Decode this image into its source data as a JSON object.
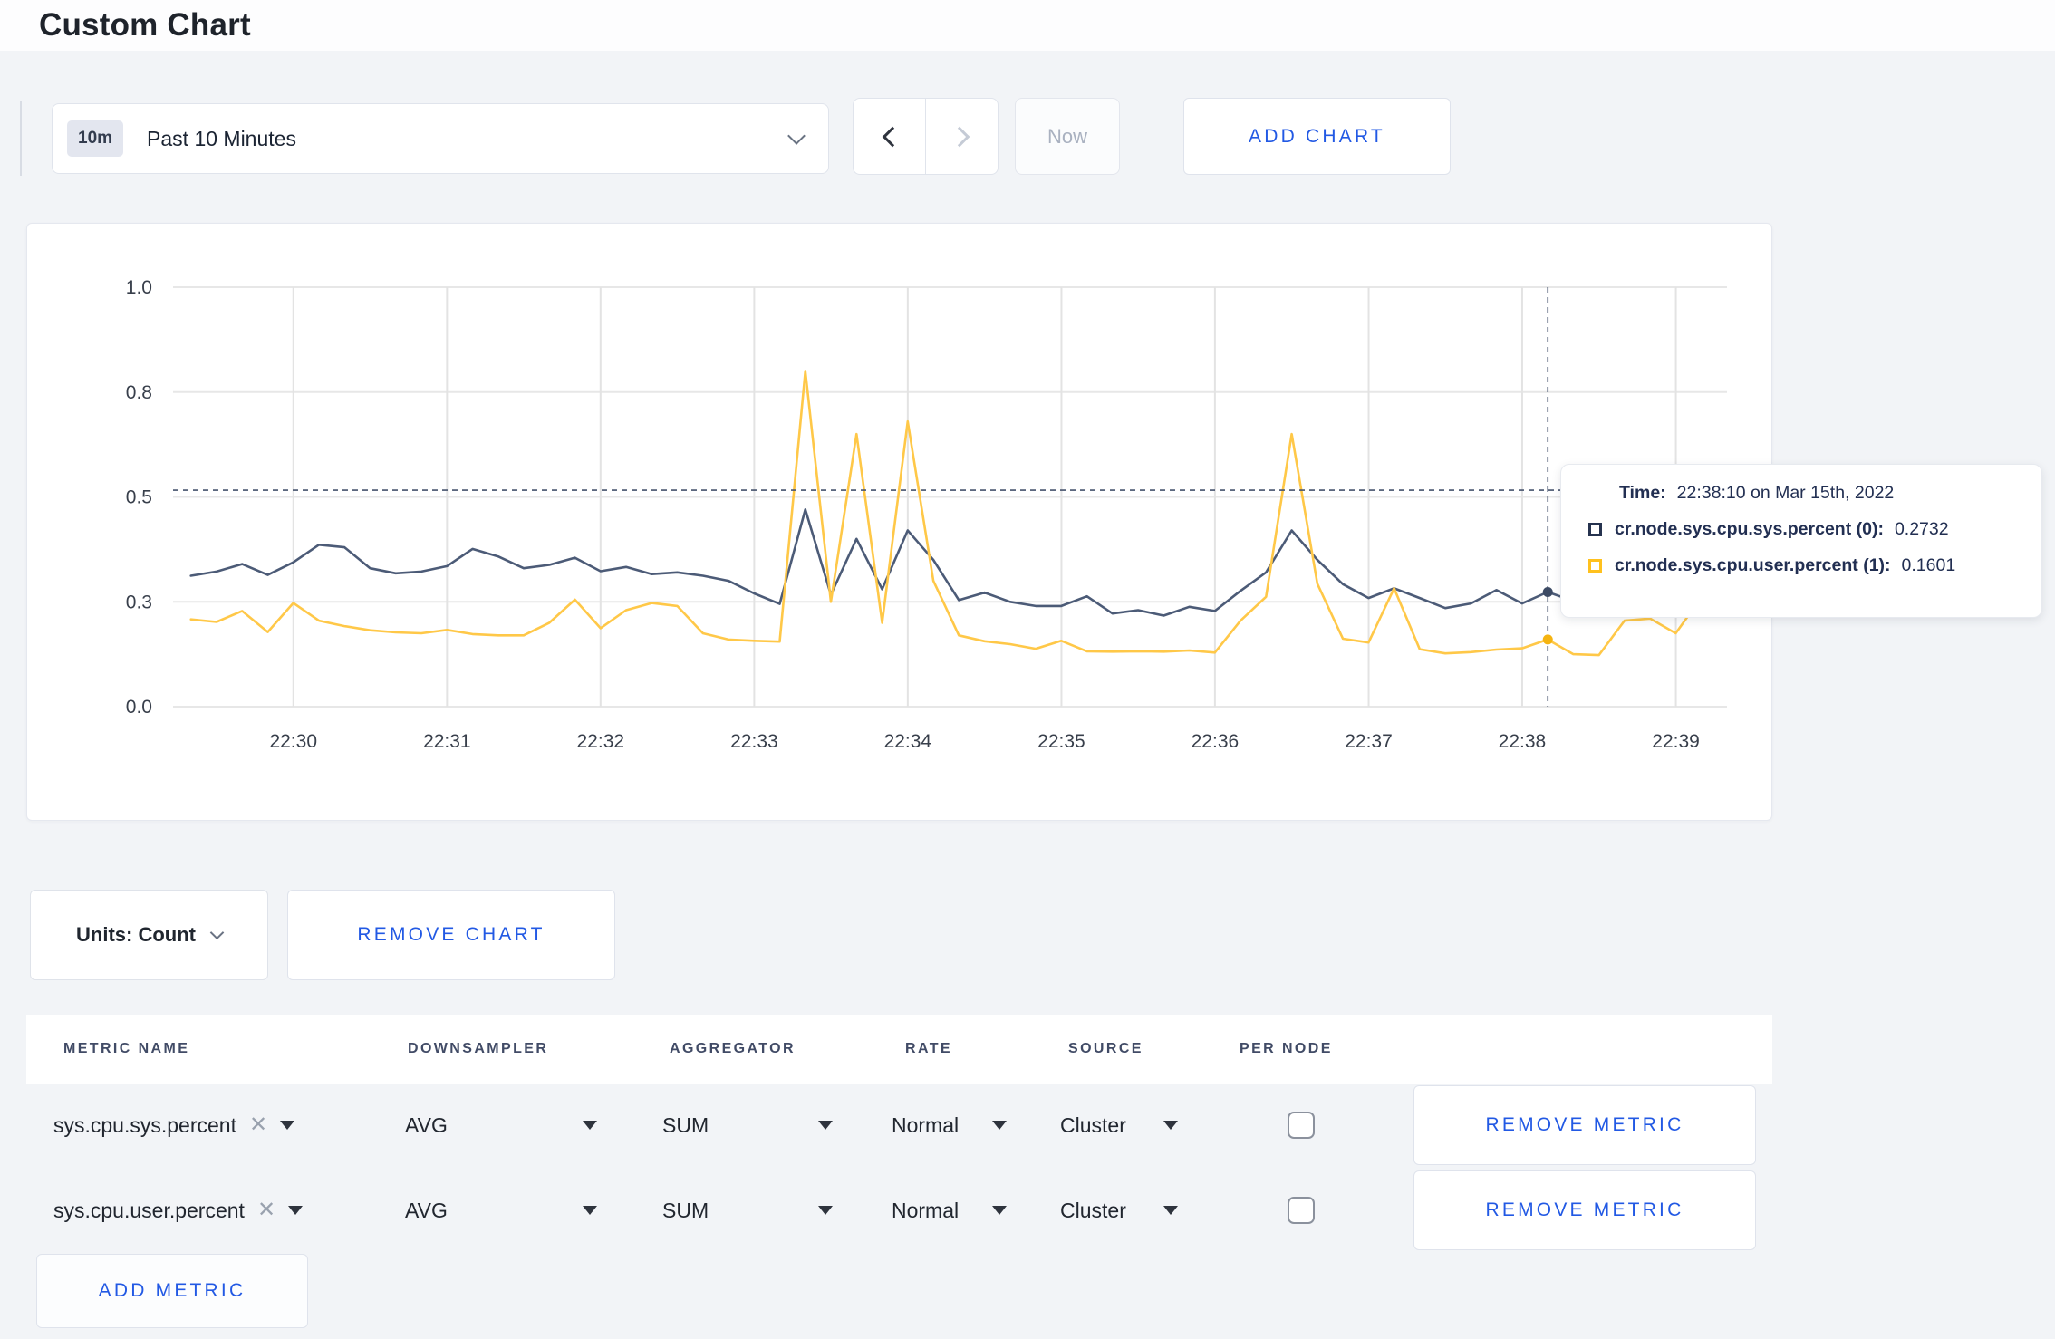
{
  "page_title": "Custom Chart",
  "toolbar": {
    "time_badge": "10m",
    "time_label": "Past 10 Minutes",
    "now_label": "Now",
    "add_chart_label": "ADD CHART"
  },
  "chart_controls": {
    "units_label": "Units: Count",
    "remove_chart_label": "REMOVE CHART",
    "add_metric_label": "ADD METRIC"
  },
  "tooltip": {
    "time_label": "Time:",
    "time_value": "22:38:10 on Mar 15th, 2022",
    "rows": [
      {
        "label": "cr.node.sys.cpu.sys.percent (0):",
        "value": "0.2732",
        "swatch_color": "#26334f"
      },
      {
        "label": "cr.node.sys.cpu.user.percent (1):",
        "value": "0.1601",
        "swatch_color": "#ffc11e"
      }
    ]
  },
  "metrics_table": {
    "headers": [
      "METRIC NAME",
      "DOWNSAMPLER",
      "AGGREGATOR",
      "RATE",
      "SOURCE",
      "PER NODE"
    ],
    "remove_metric_label": "REMOVE METRIC",
    "rows": [
      {
        "name": "sys.cpu.sys.percent",
        "downsampler": "AVG",
        "aggregator": "SUM",
        "rate": "Normal",
        "source": "Cluster",
        "per_node_checked": false
      },
      {
        "name": "sys.cpu.user.percent",
        "downsampler": "AVG",
        "aggregator": "SUM",
        "rate": "Normal",
        "source": "Cluster",
        "per_node_checked": false
      }
    ]
  },
  "colors": {
    "accent_blue": "#2259e4",
    "page_background": "#f2f4f7",
    "series_sys": "#4c5b77",
    "series_user": "#ffc848",
    "crosshair": "#46536d"
  },
  "chart_data": {
    "type": "line",
    "title": "",
    "xlabel": "",
    "ylabel": "",
    "ylim": [
      0,
      1
    ],
    "grid": true,
    "legend_position": "tooltip",
    "x_ticks": [
      {
        "label": "22:30",
        "frac": 0.0774
      },
      {
        "label": "22:31",
        "frac": 0.1763
      },
      {
        "label": "22:32",
        "frac": 0.2751
      },
      {
        "label": "22:33",
        "frac": 0.374
      },
      {
        "label": "22:34",
        "frac": 0.4728
      },
      {
        "label": "22:35",
        "frac": 0.5717
      },
      {
        "label": "22:36",
        "frac": 0.6705
      },
      {
        "label": "22:37",
        "frac": 0.7694
      },
      {
        "label": "22:38",
        "frac": 0.8682
      },
      {
        "label": "22:39",
        "frac": 0.9671
      }
    ],
    "y_ticks": [
      {
        "label": "0.0",
        "value": 0
      },
      {
        "label": "0.3",
        "value": 0.25
      },
      {
        "label": "0.5",
        "value": 0.5
      },
      {
        "label": "0.8",
        "value": 0.75
      },
      {
        "label": "1.0",
        "value": 1
      }
    ],
    "sample_interval_s": 10,
    "x_window": "22:29:20 - 22:39:20",
    "data_start_frac": 0.0115,
    "sample_step_frac": 0.016474,
    "series": [
      {
        "name": "cr.node.sys.cpu.sys.percent",
        "color": "#4c5b77",
        "dot_color": "#3c4a64",
        "values": [
          0.312,
          0.322,
          0.34,
          0.314,
          0.344,
          0.386,
          0.38,
          0.33,
          0.318,
          0.322,
          0.335,
          0.376,
          0.358,
          0.33,
          0.338,
          0.355,
          0.323,
          0.333,
          0.316,
          0.32,
          0.312,
          0.3,
          0.27,
          0.245,
          0.47,
          0.267,
          0.4,
          0.28,
          0.42,
          0.35,
          0.254,
          0.272,
          0.25,
          0.24,
          0.24,
          0.263,
          0.222,
          0.23,
          0.217,
          0.238,
          0.228,
          0.276,
          0.32,
          0.42,
          0.35,
          0.292,
          0.259,
          0.282,
          0.259,
          0.235,
          0.246,
          0.278,
          0.246,
          0.2732,
          0.252,
          0.262,
          0.285,
          0.27,
          0.284,
          0.262,
          0.29
        ]
      },
      {
        "name": "cr.node.sys.cpu.user.percent",
        "color": "#ffc848",
        "dot_color": "#f5b411",
        "values": [
          0.208,
          0.202,
          0.228,
          0.178,
          0.247,
          0.205,
          0.192,
          0.182,
          0.177,
          0.175,
          0.183,
          0.173,
          0.17,
          0.17,
          0.2,
          0.255,
          0.187,
          0.23,
          0.247,
          0.24,
          0.175,
          0.16,
          0.157,
          0.155,
          0.8,
          0.25,
          0.65,
          0.2,
          0.68,
          0.3,
          0.17,
          0.156,
          0.149,
          0.138,
          0.157,
          0.132,
          0.131,
          0.132,
          0.131,
          0.134,
          0.129,
          0.205,
          0.262,
          0.65,
          0.293,
          0.162,
          0.153,
          0.282,
          0.137,
          0.127,
          0.13,
          0.136,
          0.139,
          0.1601,
          0.125,
          0.123,
          0.205,
          0.21,
          0.175,
          0.26,
          0.255
        ]
      }
    ],
    "crosshair": {
      "time": "22:38:10",
      "x_frac": 0.8847,
      "line_y_frac": 0.516,
      "point_values": [
        0.2732,
        0.1601
      ]
    }
  }
}
